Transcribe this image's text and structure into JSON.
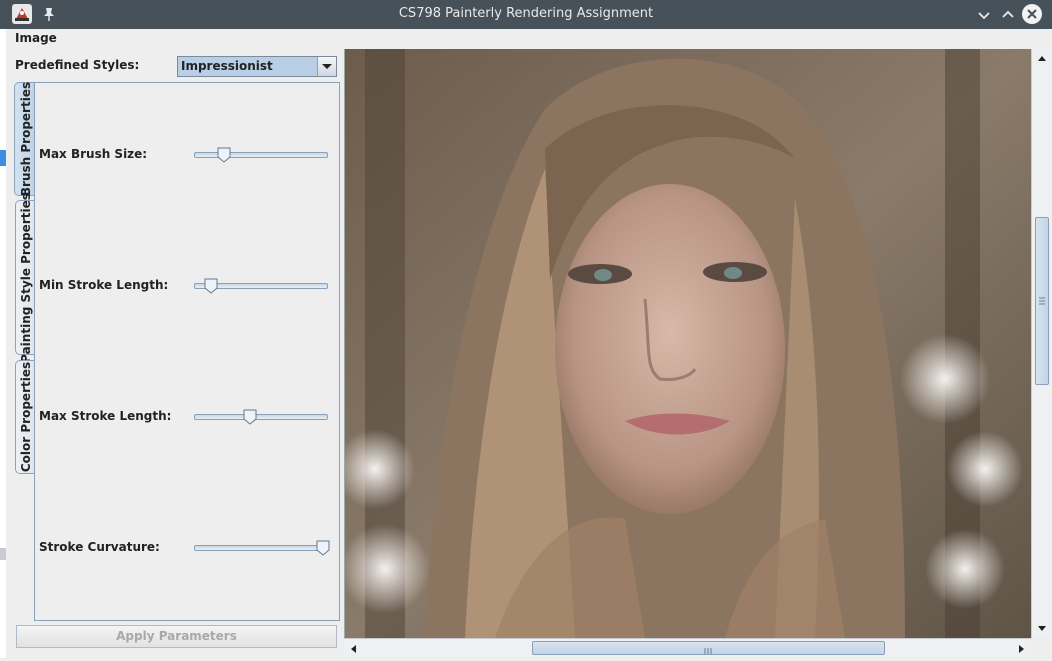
{
  "window": {
    "title": "CS798 Painterly Rendering Assignment"
  },
  "menubar": {
    "items": [
      {
        "label": "Image"
      }
    ]
  },
  "styles": {
    "label": "Predefined Styles:",
    "selected": "Impressionist"
  },
  "tabs": [
    {
      "label": "Brush Properties",
      "selected": true
    },
    {
      "label": "Painting Style Properties",
      "selected": false
    },
    {
      "label": "Color Properties",
      "selected": false
    }
  ],
  "brush": {
    "sliders": [
      {
        "label": "Max Brush Size:",
        "value": 0.2
      },
      {
        "label": "Min Stroke Length:",
        "value": 0.1
      },
      {
        "label": "Max Stroke Length:",
        "value": 0.41
      },
      {
        "label": "Stroke Curvature:",
        "value": 1.0
      }
    ]
  },
  "apply": {
    "label": "Apply Parameters"
  },
  "canvas": {
    "description": "painterly rendered portrait"
  },
  "scroll": {
    "vertical": 0.35,
    "horizontal": 0.28
  },
  "colors": {
    "titlebar": "#46515a",
    "selection": "#b8cfe5"
  }
}
